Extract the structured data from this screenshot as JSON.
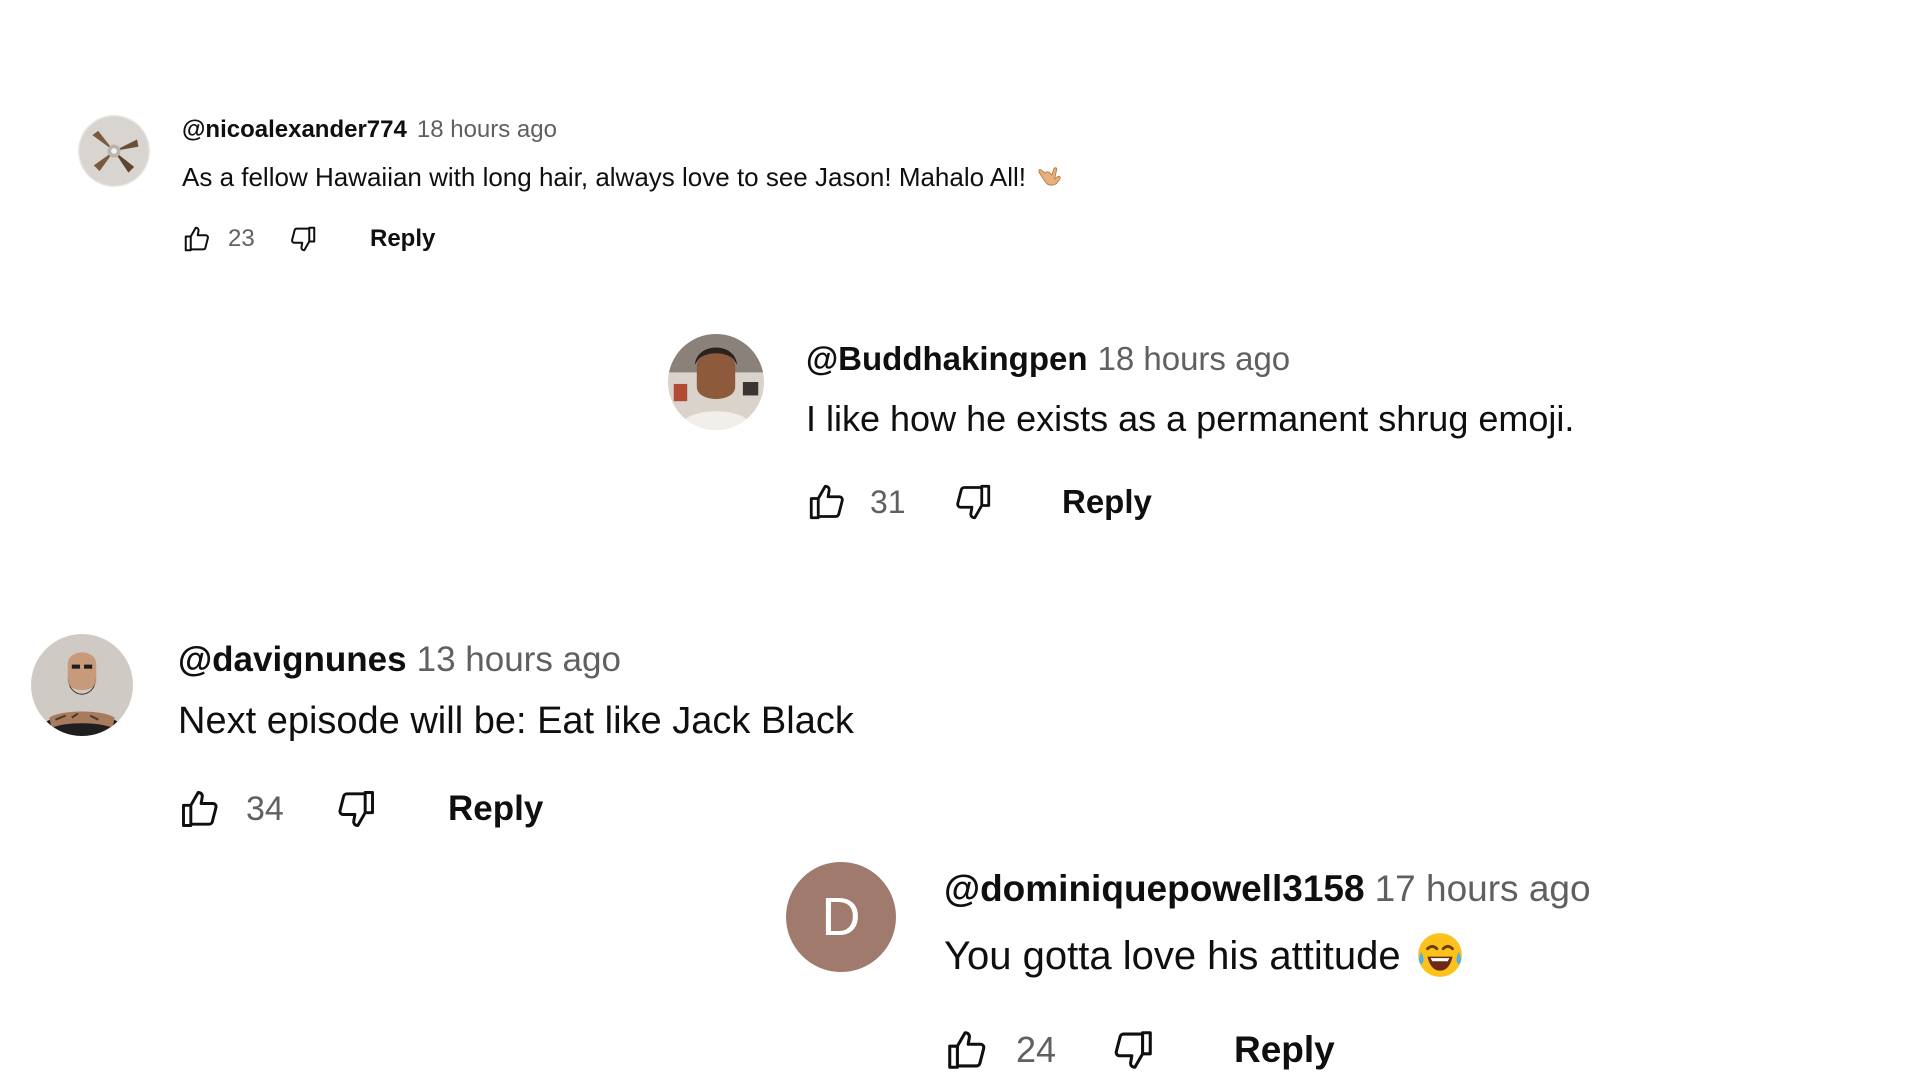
{
  "comments": [
    {
      "author": "@nicoalexander774",
      "time": "18 hours ago",
      "text": "As a fellow Hawaiian with long hair, always love to see Jason! Mahalo All!",
      "emoji": "shaka-hand-emoji",
      "likes": "23",
      "reply_label": "Reply",
      "avatar": "ceiling-fan-photo"
    },
    {
      "author": "@Buddhakingpen",
      "time": "18 hours ago",
      "text": "I like how he exists as a permanent shrug emoji.",
      "likes": "31",
      "reply_label": "Reply",
      "avatar": "person-photo"
    },
    {
      "author": "@davignunes",
      "time": "13 hours ago",
      "text": "Next episode will be: Eat like Jack Black",
      "likes": "34",
      "reply_label": "Reply",
      "avatar": "bald-bearded-man-photo"
    },
    {
      "author": "@dominiquepowell3158",
      "time": "17 hours ago",
      "text": "You gotta love his attitude",
      "emoji": "tears-of-joy-emoji",
      "likes": "24",
      "reply_label": "Reply",
      "avatar_letter": "D",
      "avatar_color": "#a07a6c"
    }
  ],
  "icons": {
    "like": "thumbs-up-icon",
    "dislike": "thumbs-down-icon"
  }
}
